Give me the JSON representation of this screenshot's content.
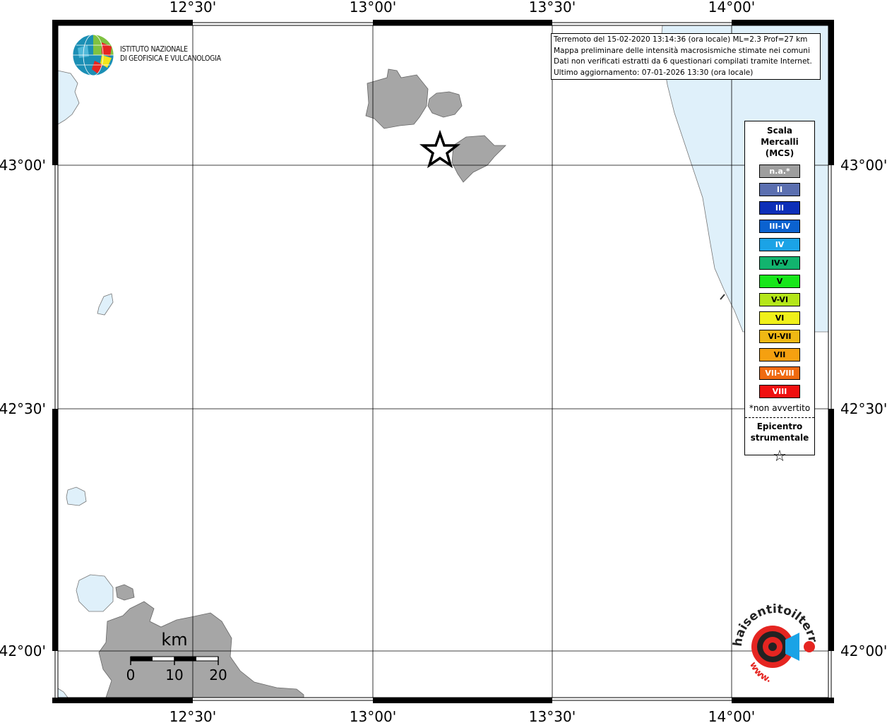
{
  "institute": {
    "name_line1": "ISTITUTO NAZIONALE",
    "name_line2": "DI GEOFISICA E VULCANOLOGIA"
  },
  "info": {
    "line1": "Terremoto del 15-02-2020 13:14:36 (ora locale) ML=2.3 Prof=27 km",
    "line2": "Mappa preliminare delle intensità macrosismiche stimate nei comuni",
    "line3": "Dati non verificati estratti da 6 questionari compilati tramite Internet.",
    "line4": "Ultimo aggiornamento: 07-01-2026 13:30 (ora locale)"
  },
  "axes": {
    "lon_labels": [
      "12°30'",
      "13°00'",
      "13°30'",
      "14°00'"
    ],
    "lat_labels": [
      "43°00'",
      "42°30'",
      "42°00'"
    ]
  },
  "legend": {
    "title_line1": "Scala",
    "title_line2": "Mercalli",
    "title_line3": "(MCS)",
    "items": [
      {
        "label": "n.a.*",
        "color": "#9e9e9e"
      },
      {
        "label": "II",
        "color": "#5b6fb0"
      },
      {
        "label": "III",
        "color": "#0d2fb8"
      },
      {
        "label": "III-IV",
        "color": "#0b62d0"
      },
      {
        "label": "IV",
        "color": "#1ba3e6"
      },
      {
        "label": "IV-V",
        "color": "#12b46e"
      },
      {
        "label": "V",
        "color": "#17e61a"
      },
      {
        "label": "V-VI",
        "color": "#b4e61a"
      },
      {
        "label": "VI",
        "color": "#f0f01a"
      },
      {
        "label": "VI-VII",
        "color": "#f0b814"
      },
      {
        "label": "VII",
        "color": "#f5a010"
      },
      {
        "label": "VII-VIII",
        "color": "#f06a10"
      },
      {
        "label": "VIII",
        "color": "#f01010"
      }
    ],
    "note": "*non avvertito",
    "epicenter_line1": "Epicentro",
    "epicenter_line2": "strumentale",
    "epicenter_symbol": "☆"
  },
  "scalebar": {
    "unit": "km",
    "ticks": [
      "0",
      "10",
      "20"
    ]
  },
  "watermark": {
    "text_top": "haisentitoilterremoto.it",
    "text_bottom": "www."
  },
  "colors": {
    "land": "#a6a6a6",
    "sea": "#dff0fa",
    "frame": "#000000"
  }
}
